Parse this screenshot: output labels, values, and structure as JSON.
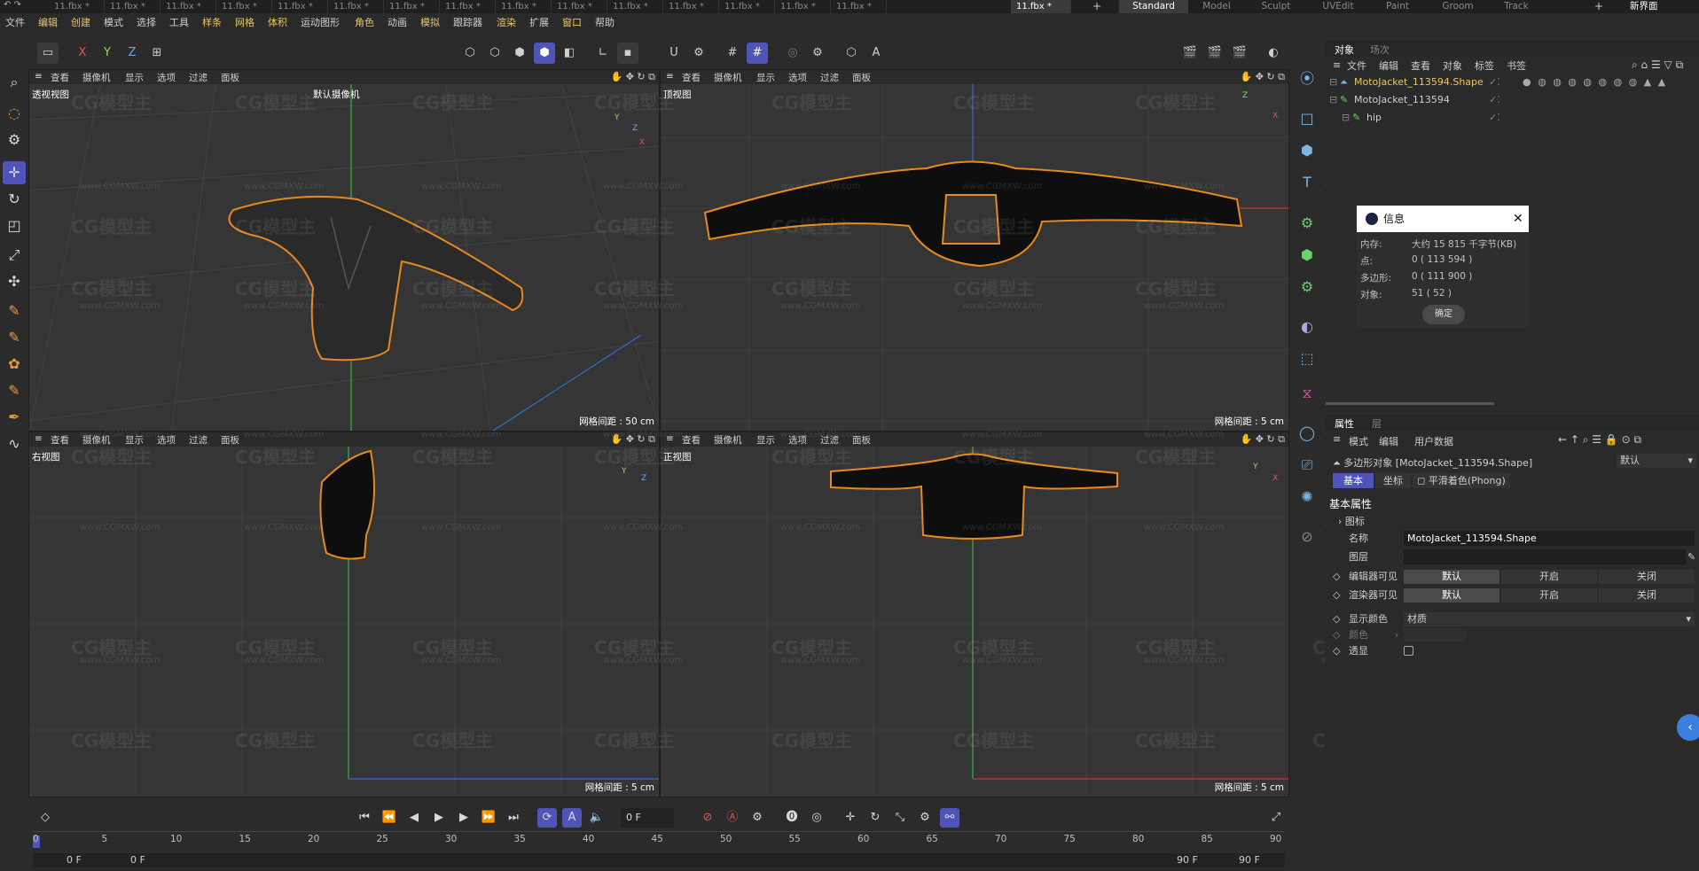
{
  "file_tabs": [
    "11.fbx *",
    "11.fbx *",
    "11.fbx *",
    "11.fbx *",
    "11.fbx *",
    "11.fbx *",
    "11.fbx *",
    "11.fbx *",
    "11.fbx *",
    "11.fbx *",
    "11.fbx *",
    "11.fbx *",
    "11.fbx *",
    "11.fbx *",
    "11.fbx *",
    "11.fbx *"
  ],
  "layout_tabs": [
    "Standard",
    "Model",
    "Sculpt",
    "UVEdit",
    "Paint",
    "Groom",
    "Track"
  ],
  "new_interface": "新界面",
  "menus": [
    "文件",
    "编辑",
    "创建",
    "模式",
    "选择",
    "工具",
    "样条",
    "网格",
    "体积",
    "运动图形",
    "角色",
    "动画",
    "模拟",
    "跟踪器",
    "渲染",
    "扩展",
    "窗口",
    "帮助"
  ],
  "axes": [
    "X",
    "Y",
    "Z"
  ],
  "move_label": "移动",
  "viewport_menu": [
    "查看",
    "摄像机",
    "显示",
    "选项",
    "过滤",
    "面板"
  ],
  "viewports": [
    {
      "name": "透视视图",
      "camera": "默认摄像机",
      "grid": "网格间距 : 50 cm"
    },
    {
      "name": "顶视图",
      "grid": "网格间距 : 5 cm"
    },
    {
      "name": "右视图",
      "grid": "网格间距 : 5 cm"
    },
    {
      "name": "正视图",
      "grid": "网格间距 : 5 cm"
    }
  ],
  "watermark": "CG模型主",
  "watermark_url": "www.CGMXW.com",
  "obj_tabs": [
    "对象",
    "场次"
  ],
  "obj_menu": [
    "文件",
    "编辑",
    "查看",
    "对象",
    "标签",
    "书签"
  ],
  "objects": [
    {
      "name": "MotoJacket_113594.Shape",
      "selected": true
    },
    {
      "name": "MotoJacket_113594",
      "selected": false
    },
    {
      "name": "hip",
      "selected": false
    }
  ],
  "info": {
    "title": "信息",
    "rows": [
      {
        "label": "内存:",
        "value": "大约 15 815 千字节(KB)"
      },
      {
        "label": "点:",
        "value": "0 ( 113 594 )"
      },
      {
        "label": "多边形:",
        "value": "0 ( 111 900 )"
      },
      {
        "label": "对象:",
        "value": "51 ( 52 )"
      }
    ],
    "ok": "确定"
  },
  "attr_tabs": [
    "属性",
    "层"
  ],
  "attr_menu": [
    "模式",
    "编辑",
    "用户数据"
  ],
  "attr_object": "多边形对象 [MotoJacket_113594.Shape]",
  "attr_default": "默认",
  "attr_subtabs": [
    "基本",
    "坐标",
    "平滑着色(Phong)"
  ],
  "basic_props": "基本属性",
  "icon_label": "图标",
  "props": {
    "name_label": "名称",
    "name_value": "MotoJacket_113594.Shape",
    "layer_label": "图层",
    "editor_visible": "编辑器可见",
    "render_visible": "渲染器可见",
    "display_color": "显示颜色",
    "display_color_value": "材质",
    "color_label": "颜色",
    "transparent": "透显",
    "opts": [
      "默认",
      "开启",
      "关闭"
    ]
  },
  "timeline": {
    "frame": "0 F",
    "ticks": [
      "0",
      "5",
      "10",
      "15",
      "20",
      "25",
      "30",
      "35",
      "40",
      "45",
      "50",
      "55",
      "60",
      "65",
      "70",
      "75",
      "80",
      "85",
      "90"
    ],
    "start": "0 F",
    "start2": "0 F",
    "end": "90 F",
    "end2": "90 F"
  },
  "colors": {
    "accent": "#4e54b8",
    "outline": "#e8891e",
    "selected_text": "#e7c760"
  }
}
